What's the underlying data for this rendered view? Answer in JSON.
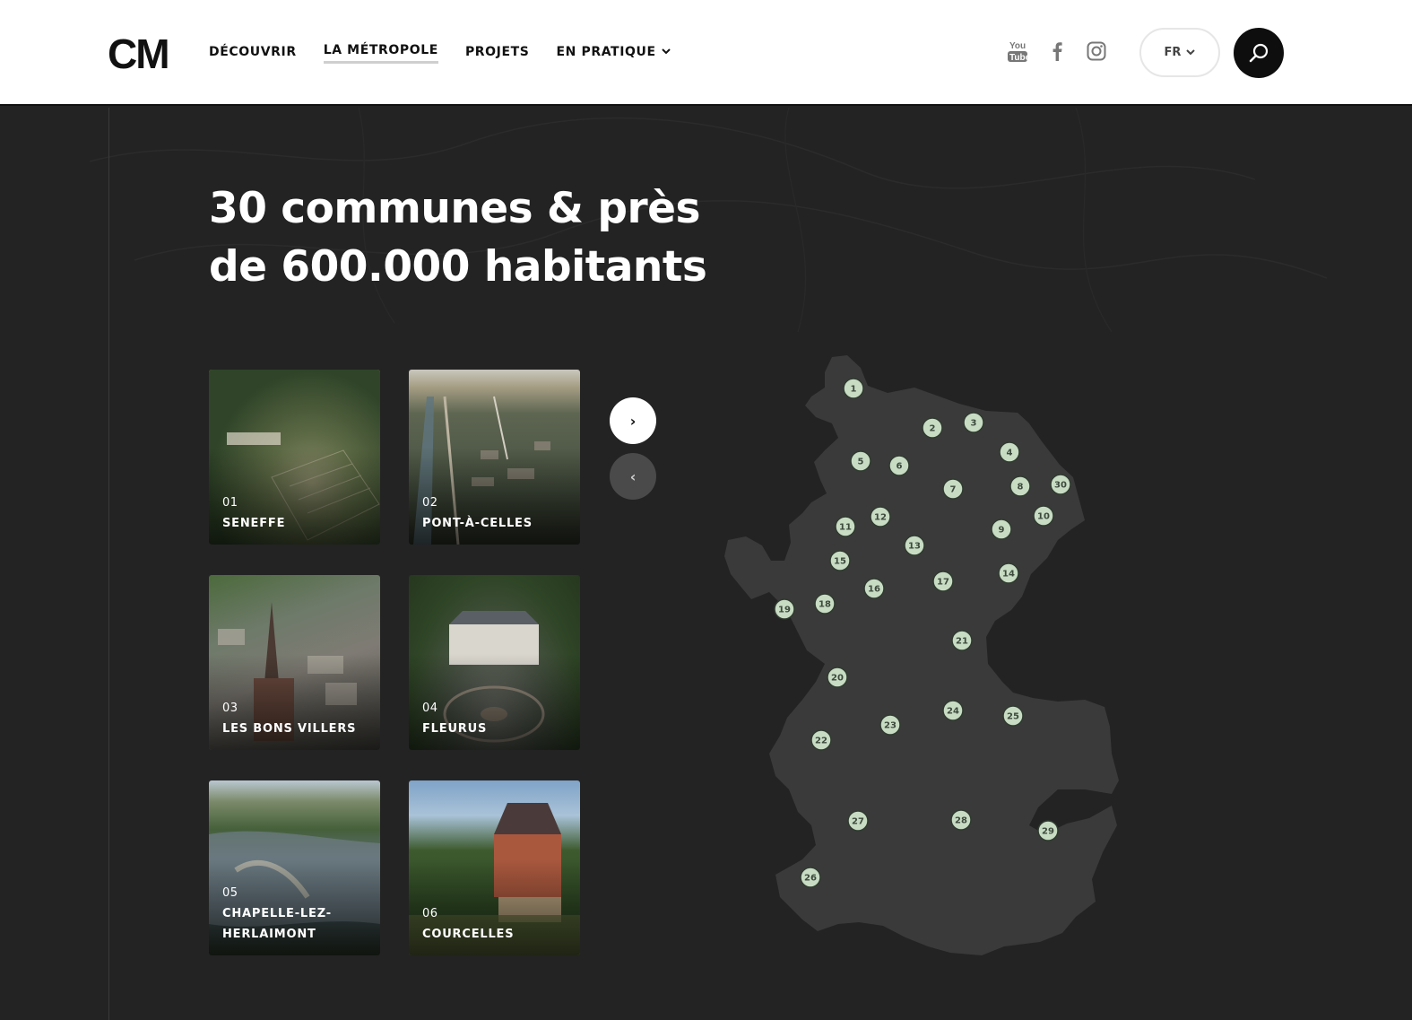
{
  "header": {
    "logo_text": "CM",
    "nav": [
      {
        "label": "DÉCOUVRIR"
      },
      {
        "label": "LA MÉTROPOLE"
      },
      {
        "label": "PROJETS"
      },
      {
        "label": "EN PRATIQUE"
      }
    ],
    "socials": [
      "youtube-icon",
      "facebook-icon",
      "instagram-icon"
    ],
    "language": "FR"
  },
  "main": {
    "headline_line1": "30 communes & près",
    "headline_line2": "de 600.000 habitants",
    "cards": [
      {
        "number": "01",
        "name": "SENEFFE"
      },
      {
        "number": "02",
        "name": "PONT-À-CELLES"
      },
      {
        "number": "03",
        "name": "LES BONS VILLERS"
      },
      {
        "number": "04",
        "name": "FLEURUS"
      },
      {
        "number": "05",
        "name_line1": "CHAPELLE-LEZ-",
        "name_line2": "HERLAIMONT"
      },
      {
        "number": "06",
        "name": "COURCELLES"
      }
    ],
    "next_icon": "›",
    "prev_icon": "‹"
  },
  "map": {
    "markers": [
      "1",
      "2",
      "3",
      "4",
      "5",
      "6",
      "7",
      "8",
      "9",
      "10",
      "11",
      "12",
      "13",
      "14",
      "15",
      "16",
      "17",
      "18",
      "19",
      "20",
      "21",
      "22",
      "23",
      "24",
      "25",
      "26",
      "27",
      "28",
      "29",
      "30"
    ]
  },
  "colors": {
    "background": "#232323",
    "map_fill": "#3a3a3a",
    "marker_fill": "#c8dcc4",
    "accent": "#ffffff"
  }
}
